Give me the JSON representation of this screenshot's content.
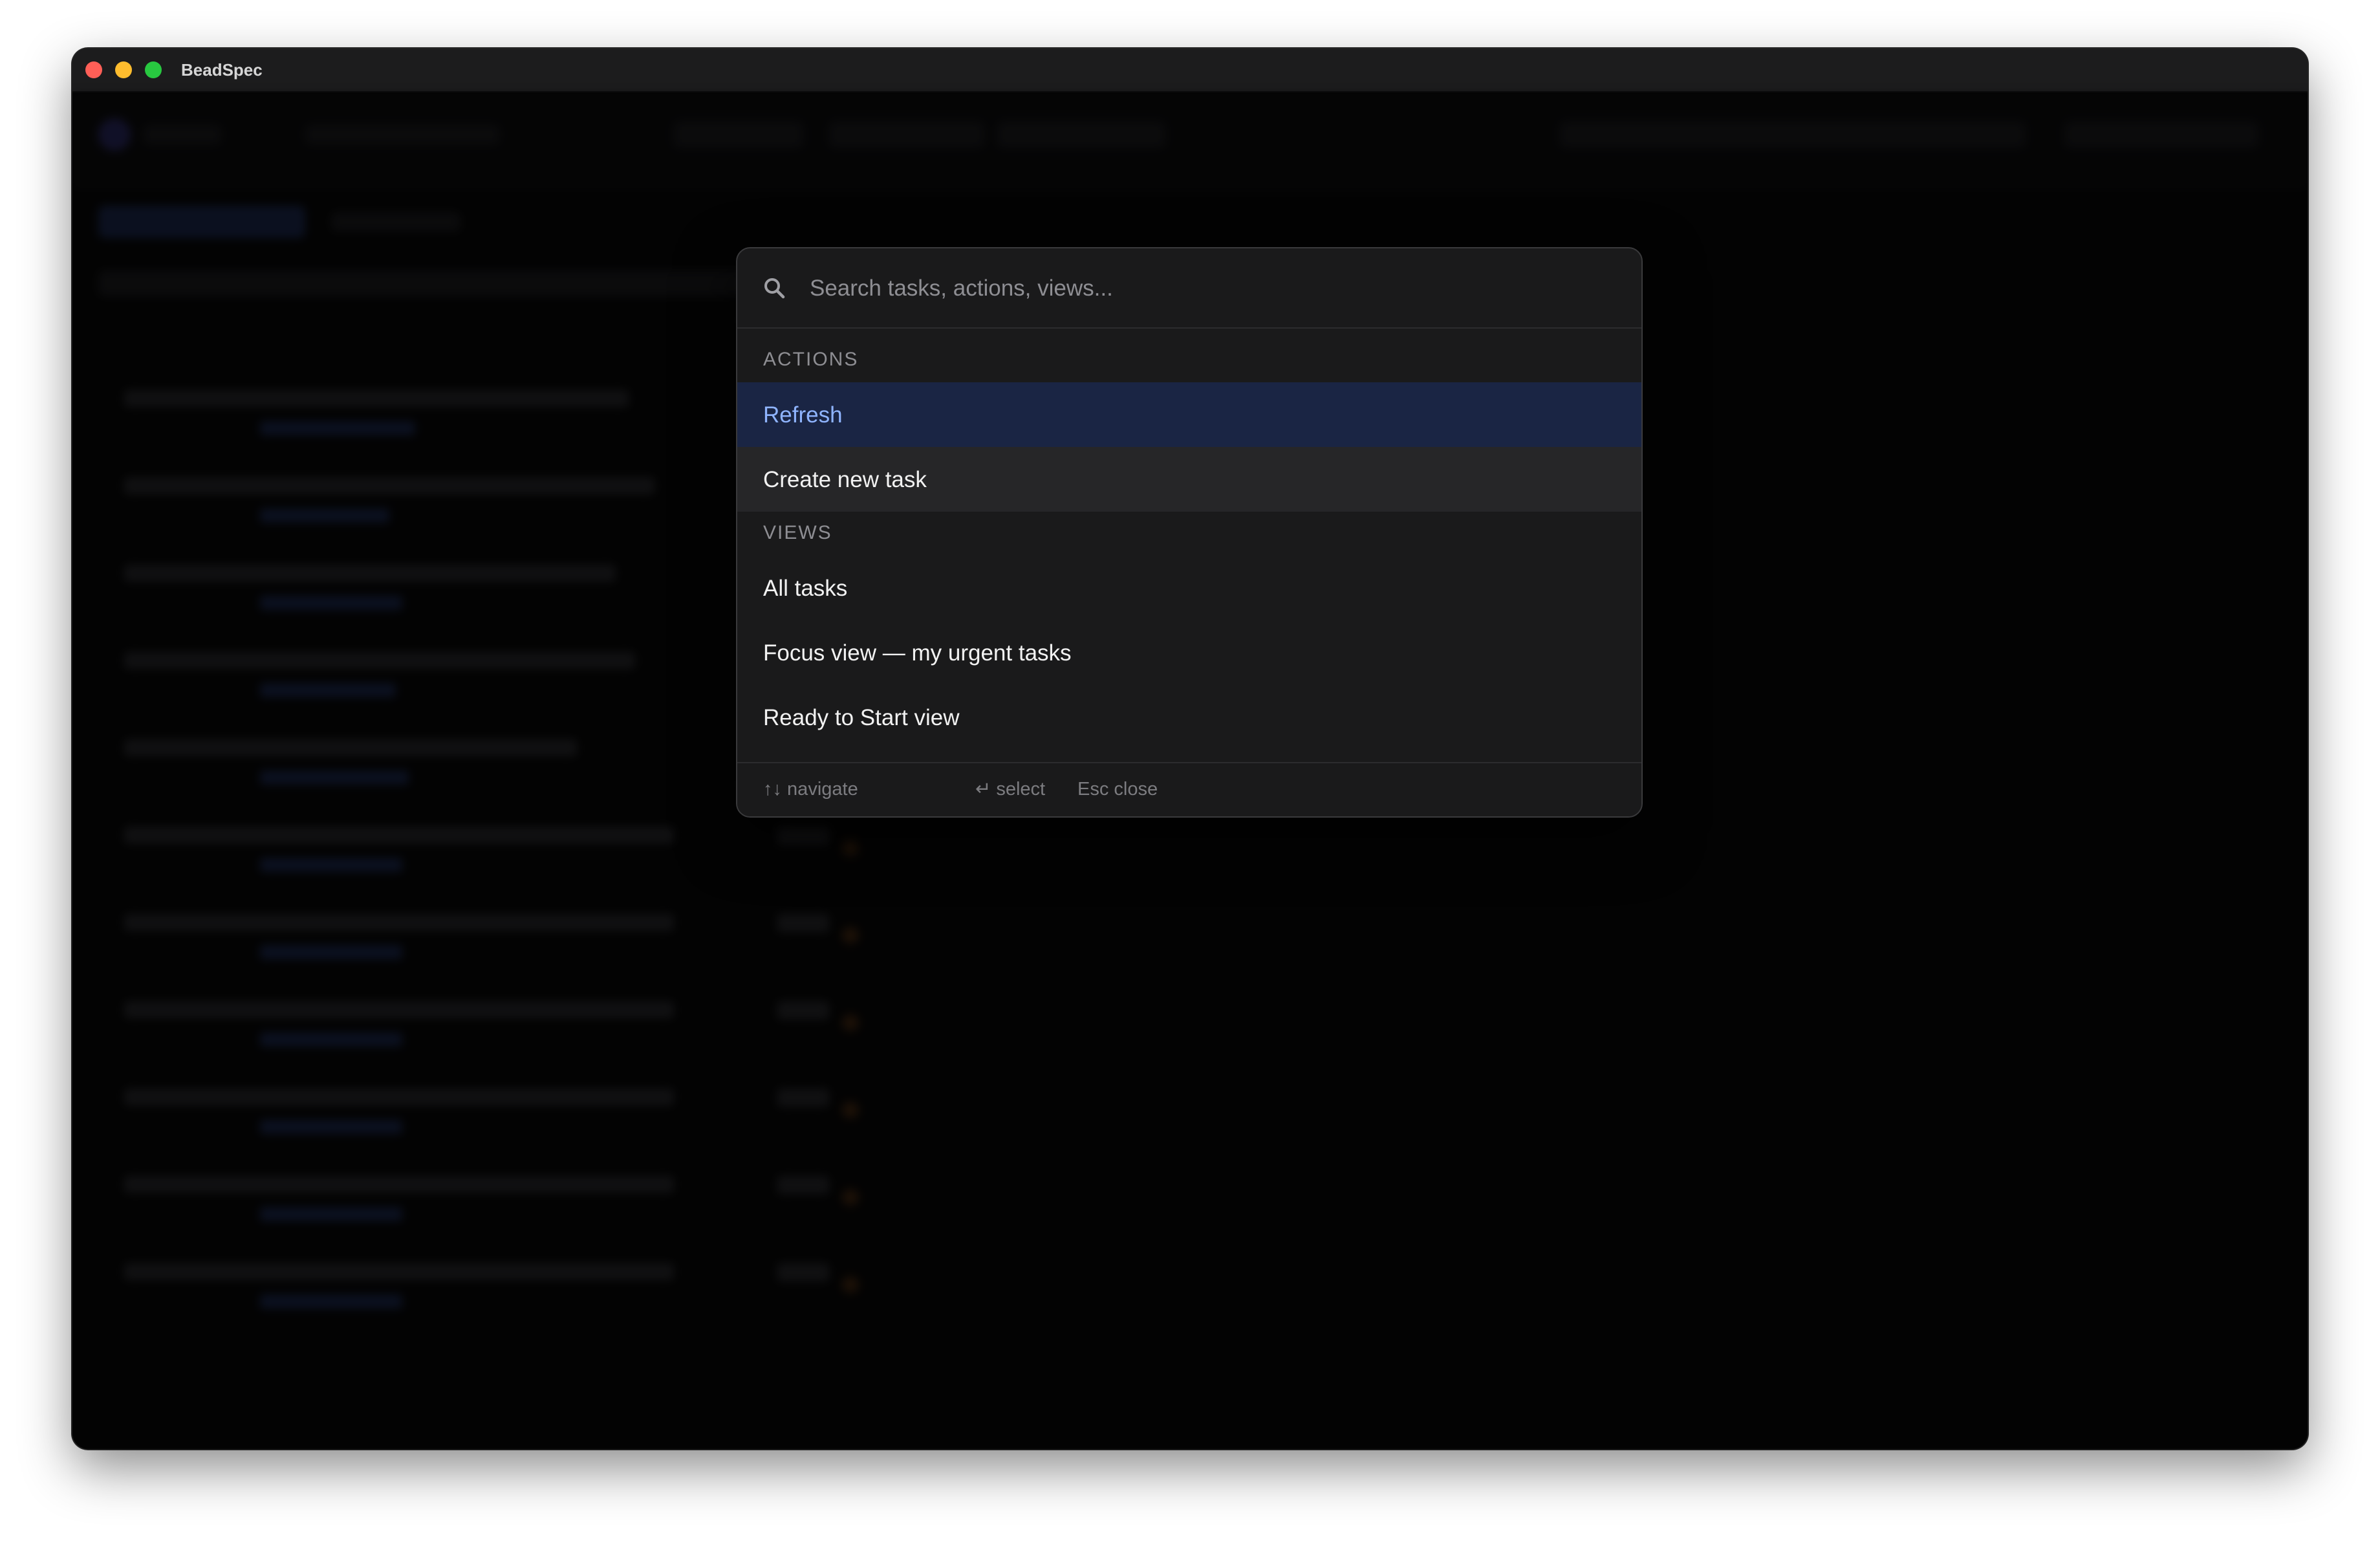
{
  "window": {
    "title": "BeadSpec"
  },
  "palette": {
    "search": {
      "placeholder": "Search tasks, actions, views...",
      "value": ""
    },
    "sections": [
      {
        "label": "ACTIONS",
        "items": [
          {
            "label": "Refresh",
            "state": "selected"
          },
          {
            "label": "Create new task",
            "state": "hover"
          }
        ]
      },
      {
        "label": "VIEWS",
        "items": [
          {
            "label": "All tasks"
          },
          {
            "label": "Focus view — my urgent tasks"
          },
          {
            "label": "Ready to Start view"
          }
        ]
      }
    ],
    "footer": {
      "navigate": "↑↓ navigate",
      "select": "↵ select",
      "close": "Esc close"
    }
  },
  "colors": {
    "selected_bg": "#1a2544",
    "selected_text": "#8fb4ff",
    "hover_bg": "#262628",
    "palette_bg": "#1a1a1b"
  },
  "icons": {
    "search": "search-icon",
    "window_controls": [
      "close-icon",
      "minimize-icon",
      "maximize-icon"
    ]
  }
}
